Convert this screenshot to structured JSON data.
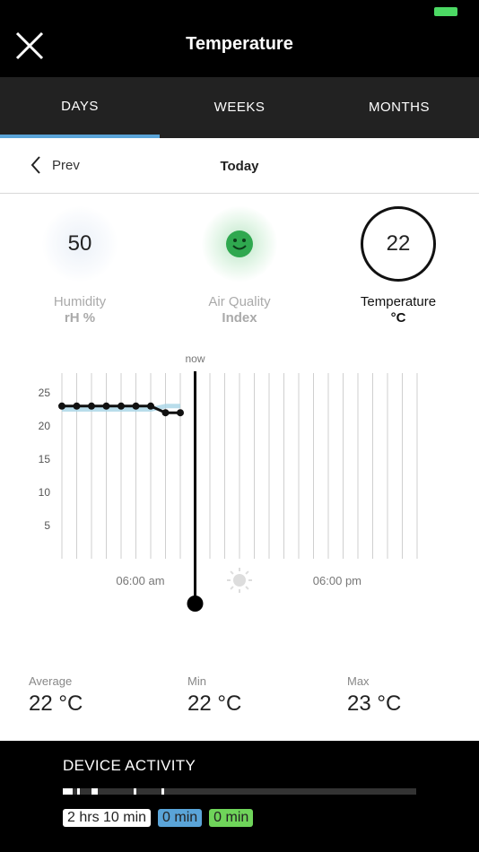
{
  "header": {
    "title": "Temperature",
    "close_icon": "close-icon"
  },
  "tabs": [
    {
      "label": "DAYS",
      "active": true
    },
    {
      "label": "WEEKS",
      "active": false
    },
    {
      "label": "MONTHS",
      "active": false
    }
  ],
  "nav": {
    "prev_label": "Prev",
    "current_label": "Today"
  },
  "stats": {
    "humidity": {
      "value": "50",
      "label": "Humidity",
      "unit": "rH %"
    },
    "air_quality": {
      "icon": "smiley-face-icon",
      "label": "Air Quality",
      "unit": "Index",
      "color": "#3cb878"
    },
    "temperature": {
      "value": "22",
      "label": "Temperature",
      "unit": "°C"
    }
  },
  "chart_data": {
    "type": "line",
    "now_label": "now",
    "ylim": [
      0,
      25
    ],
    "yticks": [
      25,
      20,
      15,
      10,
      5
    ],
    "xtick_labels": [
      "06:00 am",
      "06:00 pm"
    ],
    "x_hours": [
      0,
      1,
      2,
      3,
      4,
      5,
      6,
      7,
      8
    ],
    "values": [
      23,
      23,
      23,
      23,
      23,
      23,
      23,
      22,
      22
    ],
    "humidity_band": [
      22.5,
      22.5,
      22.5,
      22.5,
      22.5,
      22.5,
      22.5,
      23,
      23
    ],
    "now_hour": 9,
    "colors": {
      "line": "#111111",
      "band": "#a8d4e6",
      "grid": "#cfcfcf"
    }
  },
  "summary": [
    {
      "label": "Average",
      "value": "22 °C"
    },
    {
      "label": "Min",
      "value": "22 °C"
    },
    {
      "label": "Max",
      "value": "23 °C"
    }
  ],
  "device_activity": {
    "title": "DEVICE ACTIVITY",
    "pills": [
      {
        "text": "2 hrs 10 min",
        "color": "#ffffff"
      },
      {
        "text": "0 min",
        "color": "#5aa4d8"
      },
      {
        "text": "0 min",
        "color": "#6fd45a"
      }
    ]
  }
}
